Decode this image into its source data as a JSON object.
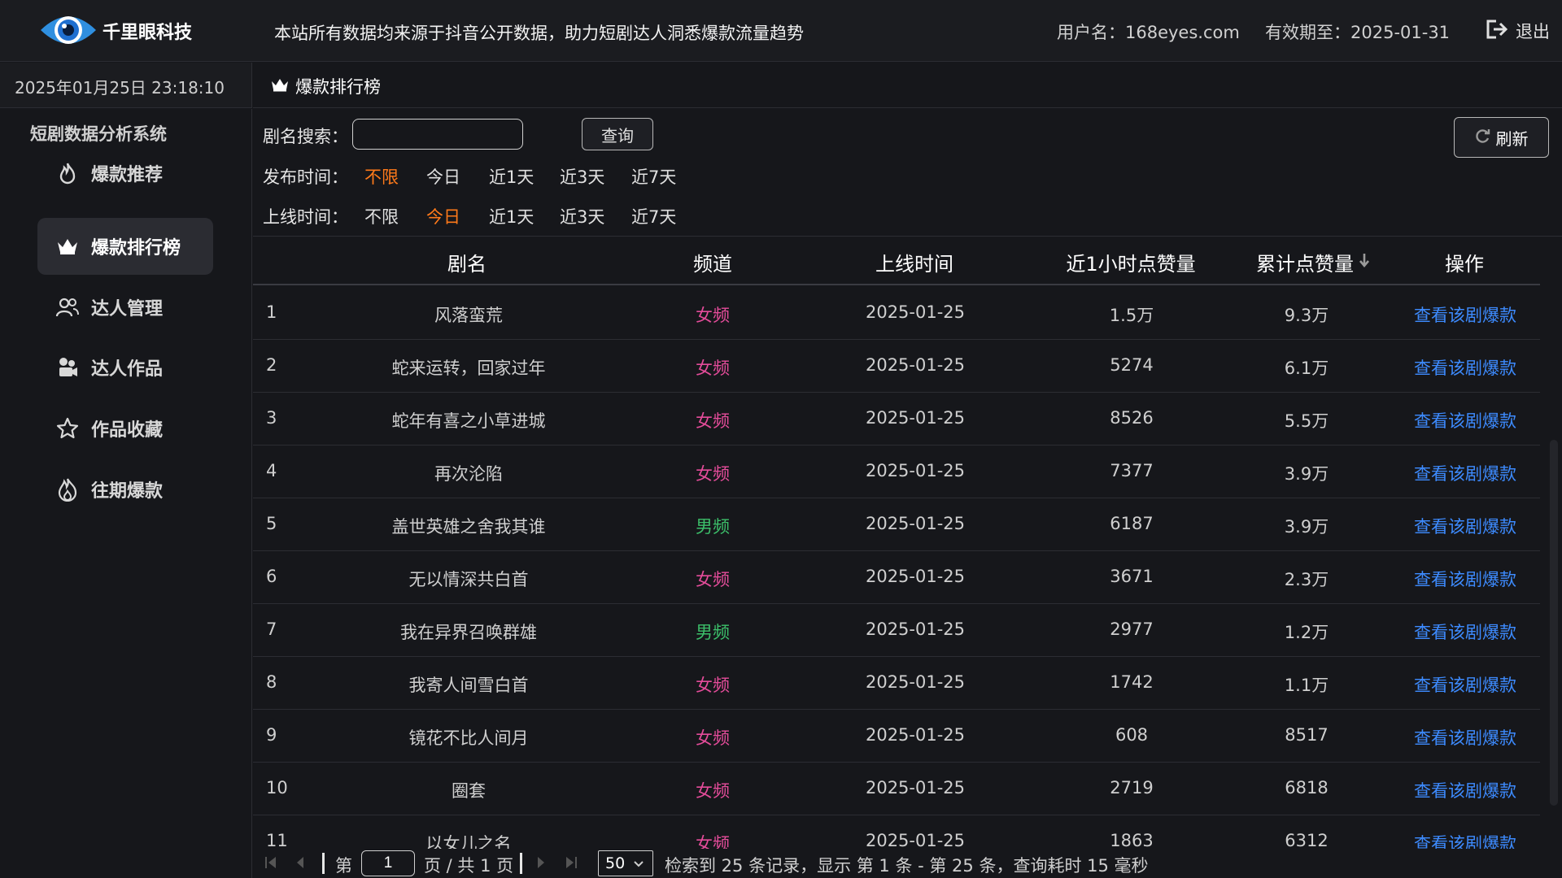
{
  "header": {
    "brand": "千里眼科技",
    "notice": "本站所有数据均来源于抖音公开数据，助力短剧达人洞悉爆款流量趋势",
    "user": "用户名：168eyes.com",
    "expire": "有效期至：2025-01-31",
    "logout": "退出"
  },
  "datetime": "2025年01月25日 23:18:10",
  "tab": {
    "label": "爆款排行榜"
  },
  "sidebar": {
    "title": "短剧数据分析系统",
    "items": [
      {
        "label": "爆款推荐",
        "icon": "flame-icon"
      },
      {
        "label": "爆款排行榜",
        "icon": "crown-icon",
        "active": true
      },
      {
        "label": "达人管理",
        "icon": "users-icon"
      },
      {
        "label": "达人作品",
        "icon": "film-icon"
      },
      {
        "label": "作品收藏",
        "icon": "star-icon"
      },
      {
        "label": "往期爆款",
        "icon": "fire-outline-icon"
      }
    ]
  },
  "filters": {
    "search_label": "剧名搜索：",
    "search_value": "",
    "query_button": "查询",
    "refresh_button": "刷新",
    "publish": {
      "label": "发布时间：",
      "options": [
        "不限",
        "今日",
        "近1天",
        "近3天",
        "近7天"
      ],
      "selected": 0
    },
    "online": {
      "label": "上线时间：",
      "options": [
        "不限",
        "今日",
        "近1天",
        "近3天",
        "近7天"
      ],
      "selected": 1
    }
  },
  "table": {
    "headers": [
      "剧名",
      "频道",
      "上线时间",
      "近1小时点赞量",
      "累计点赞量",
      "操作"
    ],
    "rows": [
      {
        "idx": "1",
        "name": "风落蛮荒",
        "channel": "女频",
        "date": "2025-01-25",
        "hour": "1.5万",
        "total": "9.3万",
        "action": "查看该剧爆款"
      },
      {
        "idx": "2",
        "name": "蛇来运转，回家过年",
        "channel": "女频",
        "date": "2025-01-25",
        "hour": "5274",
        "total": "6.1万",
        "action": "查看该剧爆款"
      },
      {
        "idx": "3",
        "name": "蛇年有喜之小草进城",
        "channel": "女频",
        "date": "2025-01-25",
        "hour": "8526",
        "total": "5.5万",
        "action": "查看该剧爆款"
      },
      {
        "idx": "4",
        "name": "再次沦陷",
        "channel": "女频",
        "date": "2025-01-25",
        "hour": "7377",
        "total": "3.9万",
        "action": "查看该剧爆款"
      },
      {
        "idx": "5",
        "name": "盖世英雄之舍我其谁",
        "channel": "男频",
        "date": "2025-01-25",
        "hour": "6187",
        "total": "3.9万",
        "action": "查看该剧爆款"
      },
      {
        "idx": "6",
        "name": "无以情深共白首",
        "channel": "女频",
        "date": "2025-01-25",
        "hour": "3671",
        "total": "2.3万",
        "action": "查看该剧爆款"
      },
      {
        "idx": "7",
        "name": "我在异界召唤群雄",
        "channel": "男频",
        "date": "2025-01-25",
        "hour": "2977",
        "total": "1.2万",
        "action": "查看该剧爆款"
      },
      {
        "idx": "8",
        "name": "我寄人间雪白首",
        "channel": "女频",
        "date": "2025-01-25",
        "hour": "1742",
        "total": "1.1万",
        "action": "查看该剧爆款"
      },
      {
        "idx": "9",
        "name": "镜花不比人间月",
        "channel": "女频",
        "date": "2025-01-25",
        "hour": "608",
        "total": "8517",
        "action": "查看该剧爆款"
      },
      {
        "idx": "10",
        "name": "圈套",
        "channel": "女频",
        "date": "2025-01-25",
        "hour": "2719",
        "total": "6818",
        "action": "查看该剧爆款"
      },
      {
        "idx": "11",
        "name": "以女儿之名",
        "channel": "女频",
        "date": "2025-01-25",
        "hour": "1863",
        "total": "6312",
        "action": "查看该剧爆款"
      }
    ]
  },
  "pager": {
    "prefix": "第",
    "page": "1",
    "suffix": "页 / 共 1 页",
    "page_size": "50",
    "summary": "检索到 25 条记录，显示 第 1 条 - 第 25 条，查询耗时 15 毫秒"
  },
  "colors": {
    "selected": "#ff7a1a",
    "female": "#e44c9a",
    "male": "#3cbf6a",
    "link": "#3d8bff"
  }
}
